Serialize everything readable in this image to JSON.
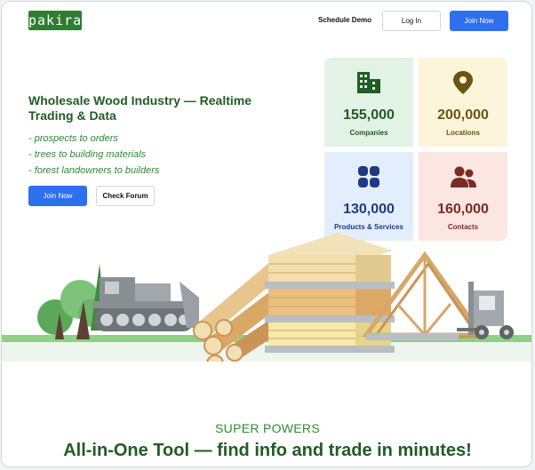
{
  "brand": {
    "logo_text": "pakira"
  },
  "nav": {
    "schedule_demo": "Schedule Demo",
    "log_in": "Log In",
    "join_now": "Join Now"
  },
  "hero": {
    "title": "Wholesale Wood Industry — Realtime Trading & Data",
    "bullets": [
      "- prospects to orders",
      "- trees to building materials",
      "- forest landowners to builders"
    ],
    "join_now": "Join Now",
    "check_forum": "Check Forum"
  },
  "stats": [
    {
      "value": "155,000",
      "label": "Companies",
      "icon": "building-icon",
      "color": "#1f5d22"
    },
    {
      "value": "200,000",
      "label": "Locations",
      "icon": "location-pin-icon",
      "color": "#6b5414"
    },
    {
      "value": "130,000",
      "label": "Products & Services",
      "icon": "grid-icon",
      "color": "#1f3a83"
    },
    {
      "value": "160,000",
      "label": "Contacts",
      "icon": "users-icon",
      "color": "#7a2b24"
    }
  ],
  "super_powers": {
    "label": "SUPER POWERS",
    "title": "All-in-One Tool — find info and trade in minutes!"
  },
  "colors": {
    "brand_green": "#2f7d32",
    "primary_blue": "#2e6ff0"
  }
}
